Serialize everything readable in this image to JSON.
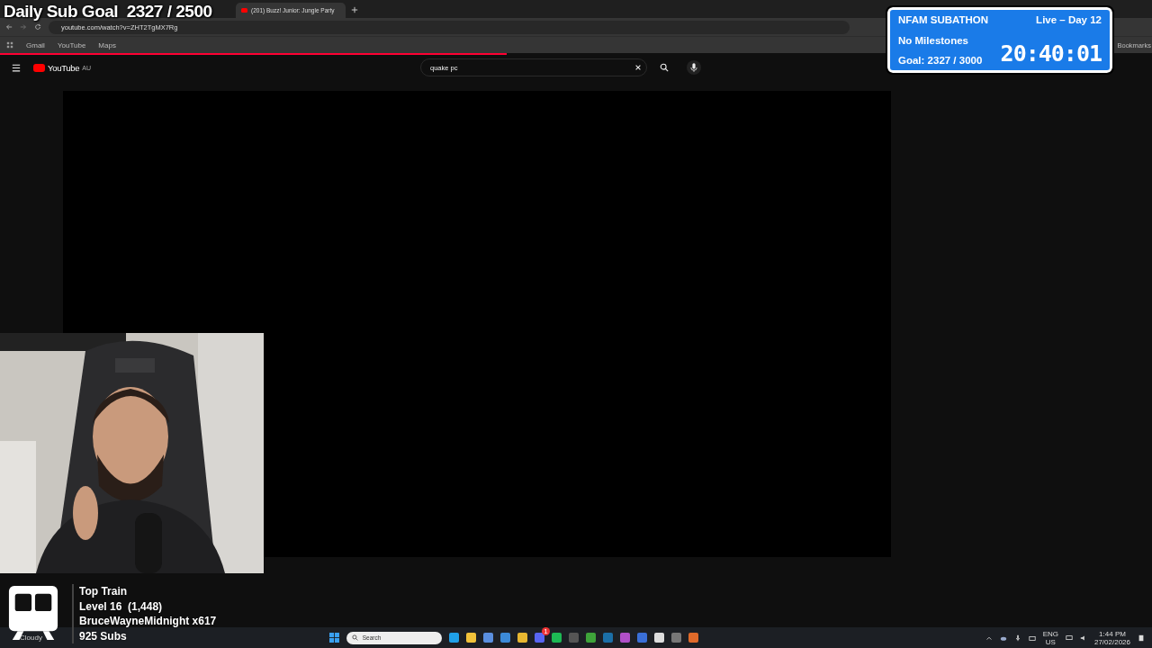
{
  "browser": {
    "tabs": [
      {
        "title": "(201) Buzz! Junior: Jungle Party",
        "selected": true
      }
    ],
    "url": "youtube.com/watch?v=ZHT2TgMX7Rg",
    "bookmarks": [
      "Gmail",
      "YouTube",
      "Maps"
    ],
    "all_bookmarks": "Bookmarks",
    "loading": {
      "level": 0.44
    }
  },
  "youtube": {
    "logo": "YouTube",
    "region": "AU",
    "search": "quake pc"
  },
  "stream_overlay": {
    "sub_goal": "Daily Sub Goal  2327 / 2500",
    "subathon": {
      "title": "NFAM SUBATHON",
      "milestones": "No Milestones",
      "goal": "Goal: 2327 / 3000",
      "status": "Live – Day 12",
      "timer": "20:40:01"
    },
    "top_train": {
      "title": "Top Train",
      "level": "Level 16  (1,448)",
      "user": "BruceWayneMidnight x617",
      "subs": "925 Subs"
    }
  },
  "taskbar": {
    "weather": "Cloudy",
    "search_placeholder": "Search",
    "badge": "1",
    "language": "ENG",
    "region": "US",
    "time": "1:44 PM",
    "date": "27/02/2026"
  }
}
